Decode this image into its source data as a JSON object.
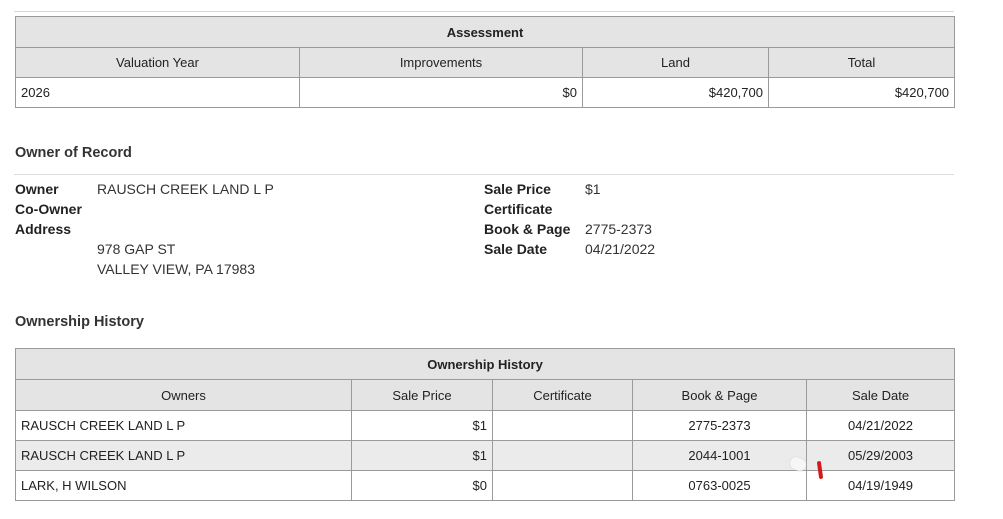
{
  "assessment": {
    "caption": "Assessment",
    "headers": [
      "Valuation Year",
      "Improvements",
      "Land",
      "Total"
    ],
    "rows": [
      [
        "2026",
        "$0",
        "$420,700",
        "$420,700"
      ]
    ]
  },
  "owner": {
    "title": "Owner of Record",
    "labels": {
      "owner": "Owner",
      "co_owner": "Co-Owner",
      "address": "Address",
      "sale_price": "Sale Price",
      "certificate": "Certificate",
      "book_page": "Book & Page",
      "sale_date": "Sale Date"
    },
    "values": {
      "owner": "RAUSCH CREEK LAND L P",
      "co_owner": "",
      "address_line1": "978 GAP ST",
      "address_line2": "VALLEY VIEW, PA 17983",
      "sale_price": "$1",
      "certificate": "",
      "book_page": "2775-2373",
      "sale_date": "04/21/2022"
    }
  },
  "history": {
    "title": "Ownership History",
    "caption": "Ownership History",
    "headers": [
      "Owners",
      "Sale Price",
      "Certificate",
      "Book & Page",
      "Sale Date"
    ],
    "rows": [
      [
        "RAUSCH CREEK LAND L P",
        "$1",
        "",
        "2775-2373",
        "04/21/2022"
      ],
      [
        "RAUSCH CREEK LAND L P",
        "$1",
        "",
        "2044-1001",
        "05/29/2003"
      ],
      [
        "LARK, H WILSON",
        "$0",
        "",
        "0763-0025",
        "04/19/1949"
      ]
    ]
  }
}
